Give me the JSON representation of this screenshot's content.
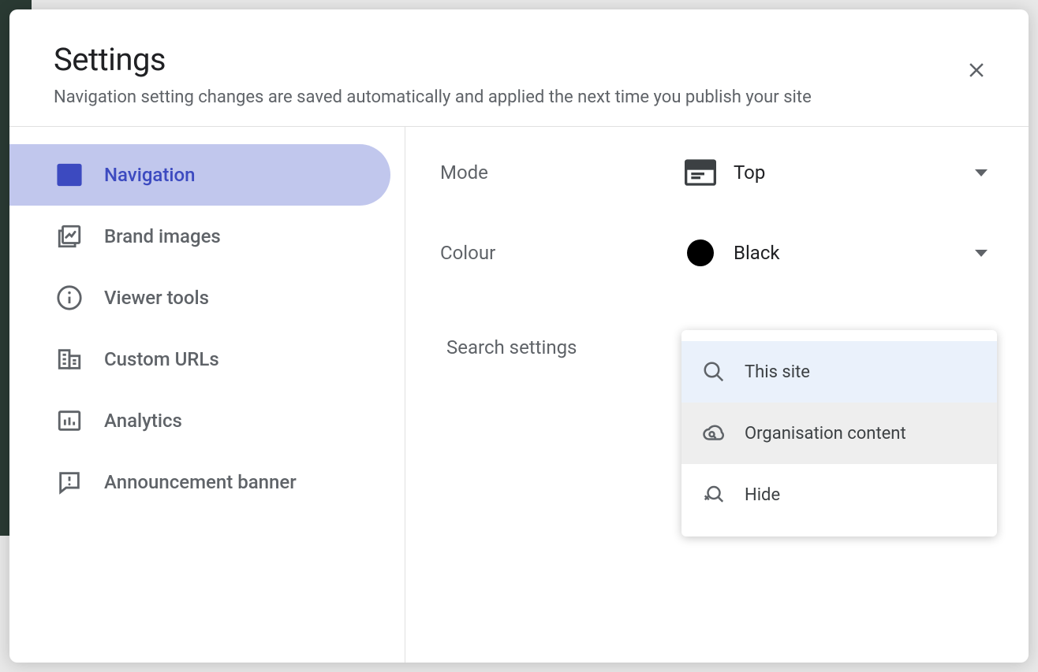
{
  "header": {
    "title": "Settings",
    "subtitle": "Navigation setting changes are saved automatically and applied the next time you publish your site"
  },
  "sidebar": {
    "items": [
      {
        "label": "Navigation",
        "active": true
      },
      {
        "label": "Brand images",
        "active": false
      },
      {
        "label": "Viewer tools",
        "active": false
      },
      {
        "label": "Custom URLs",
        "active": false
      },
      {
        "label": "Analytics",
        "active": false
      },
      {
        "label": "Announcement banner",
        "active": false
      }
    ]
  },
  "settings": {
    "mode": {
      "label": "Mode",
      "value": "Top"
    },
    "colour": {
      "label": "Colour",
      "value": "Black",
      "swatch": "#000000"
    },
    "search": {
      "label": "Search settings"
    }
  },
  "search_menu": {
    "items": [
      {
        "label": "This site",
        "state": "selected"
      },
      {
        "label": "Organisation content",
        "state": "hover"
      },
      {
        "label": "Hide",
        "state": ""
      }
    ]
  }
}
